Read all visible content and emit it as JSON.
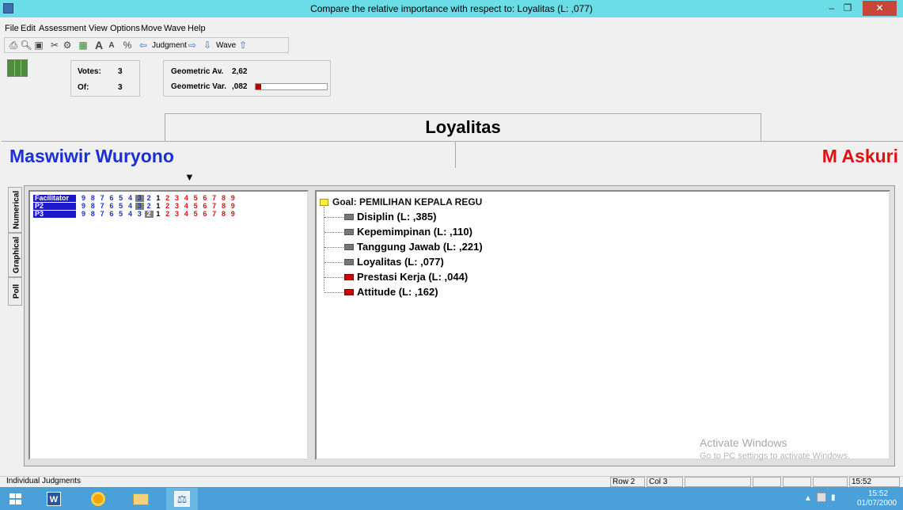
{
  "window": {
    "title": "Compare the relative importance  with respect to: Loyalitas (L: ,077)",
    "minimize": "–",
    "maximize": "❐",
    "close": "✕"
  },
  "menu": [
    "File",
    "Edit",
    "Assessment",
    "View",
    "Options",
    "Move",
    "Wave",
    "Help"
  ],
  "toolbar": {
    "judgment_label": "Judgment",
    "wave_label": "Wave"
  },
  "votes": {
    "votes_label": "Votes:",
    "votes_value": "3",
    "of_label": "Of:",
    "of_value": "3"
  },
  "geometric": {
    "av_label": "Geometric Av.",
    "av_value": "2,62",
    "var_label": "Geometric Var.",
    "var_value": ",082",
    "var_bar_fraction": 0.08
  },
  "criterion": "Loyalitas",
  "left_element": "Maswiwir Wuryono",
  "right_element": "M Askuri",
  "side_tabs": [
    "Numerical",
    "Graphical",
    "Poll"
  ],
  "judgments": [
    {
      "name": "Facilitator",
      "scale": [
        "9",
        "8",
        "7",
        "6",
        "5",
        "4",
        "3",
        "2",
        "1",
        "2",
        "3",
        "4",
        "5",
        "6",
        "7",
        "8",
        "9"
      ],
      "selected_index": 6
    },
    {
      "name": "P2",
      "scale": [
        "9",
        "8",
        "7",
        "6",
        "5",
        "4",
        "3",
        "2",
        "1",
        "2",
        "3",
        "4",
        "5",
        "6",
        "7",
        "8",
        "9"
      ],
      "selected_index": 6
    },
    {
      "name": "P3",
      "scale": [
        "9",
        "8",
        "7",
        "6",
        "5",
        "4",
        "3",
        "2",
        "1",
        "2",
        "3",
        "4",
        "5",
        "6",
        "7",
        "8",
        "9"
      ],
      "selected_index": 7
    }
  ],
  "tree": {
    "goal": "Goal: PEMILIHAN KEPALA REGU",
    "nodes": [
      {
        "label": "Disiplin (L: ,385)",
        "color": "#777777"
      },
      {
        "label": "Kepemimpinan (L: ,110)",
        "color": "#777777"
      },
      {
        "label": "Tanggung Jawab (L: ,221)",
        "color": "#777777"
      },
      {
        "label": "Loyalitas (L: ,077)",
        "color": "#777777"
      },
      {
        "label": "Prestasi Kerja (L: ,044)",
        "color": "#cc0000"
      },
      {
        "label": "Attitude (L: ,162)",
        "color": "#cc0000"
      }
    ]
  },
  "watermark": {
    "line1": "Activate Windows",
    "line2": "Go to PC settings to activate Windows."
  },
  "statusbar": {
    "mode": "Individual Judgments",
    "row": "Row 2",
    "col": "Col 3",
    "time": "15:52"
  },
  "taskbar": {
    "clock_time": "15:52",
    "clock_date": "01/07/2000"
  }
}
